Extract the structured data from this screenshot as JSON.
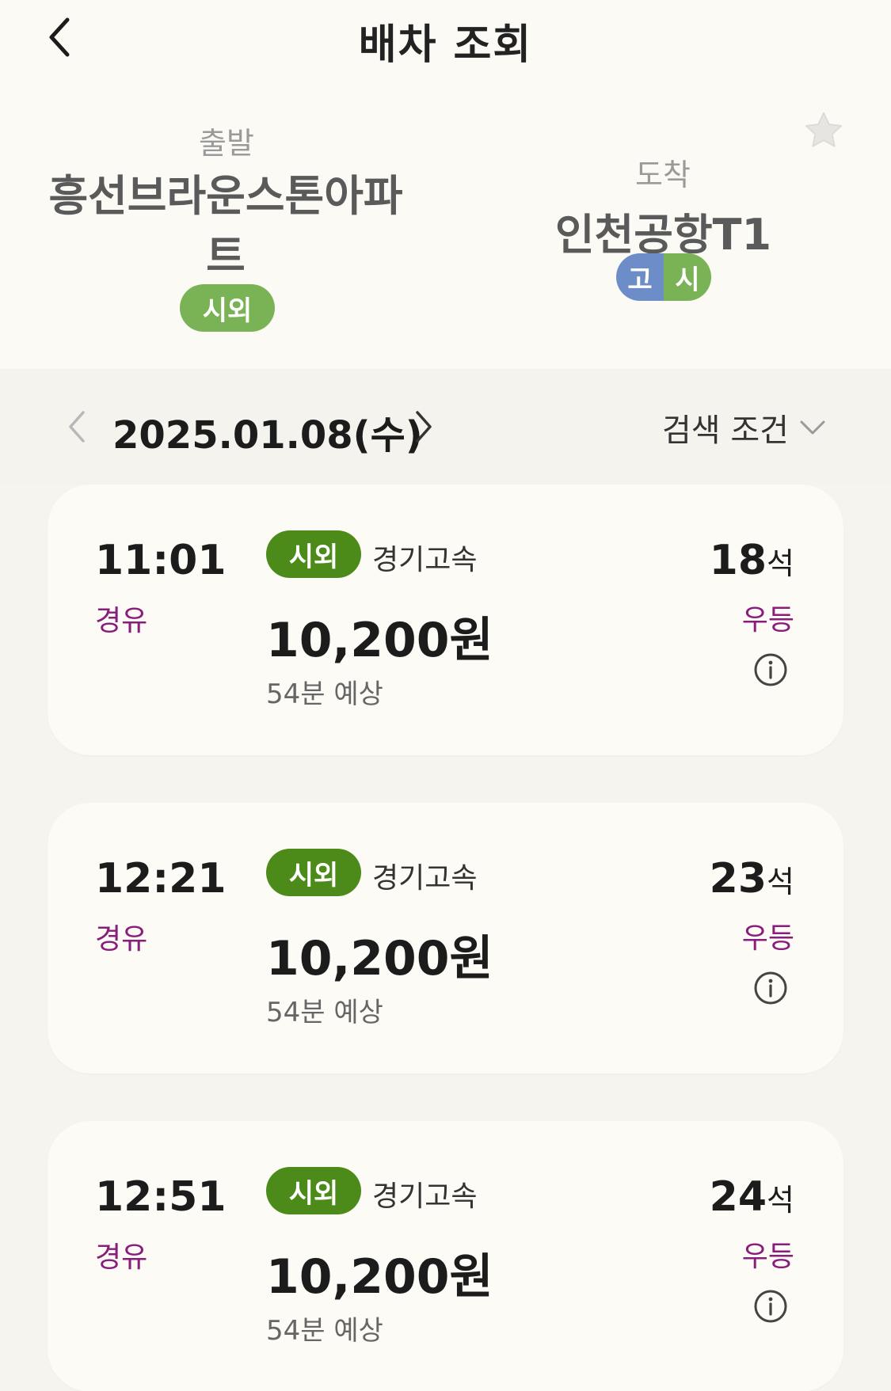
{
  "header": {
    "title": "배차 조회",
    "departure": {
      "label": "출발",
      "name": "흥선브라운스톤아파트",
      "badge": "시외"
    },
    "arrival": {
      "label": "도착",
      "name": "인천공항T1",
      "badge_left": "고",
      "badge_right": "시"
    },
    "icons": {
      "back": "back-arrow-icon",
      "favorite": "star-icon"
    }
  },
  "date_bar": {
    "date": "2025.01.08(수)",
    "filter_label": "검색 조건",
    "icons": {
      "prev": "chevron-left-icon",
      "next": "chevron-right-icon",
      "filter": "chevron-down-icon"
    }
  },
  "results": [
    {
      "time": "11:01",
      "via": "경유",
      "type": "시외",
      "company": "경기고속",
      "price": "10,200원",
      "duration": "54분 예상",
      "seats": "18",
      "seat_unit": "석",
      "grade": "우등"
    },
    {
      "time": "12:21",
      "via": "경유",
      "type": "시외",
      "company": "경기고속",
      "price": "10,200원",
      "duration": "54분 예상",
      "seats": "23",
      "seat_unit": "석",
      "grade": "우등"
    },
    {
      "time": "12:51",
      "via": "경유",
      "type": "시외",
      "company": "경기고속",
      "price": "10,200원",
      "duration": "54분 예상",
      "seats": "24",
      "seat_unit": "석",
      "grade": "우등"
    }
  ],
  "colors": {
    "intercity_badge": "#7ab356",
    "card_type_badge": "#4c8b1a",
    "express_badge": "#6c8dc8",
    "accent_purple": "#8a1c7c"
  }
}
